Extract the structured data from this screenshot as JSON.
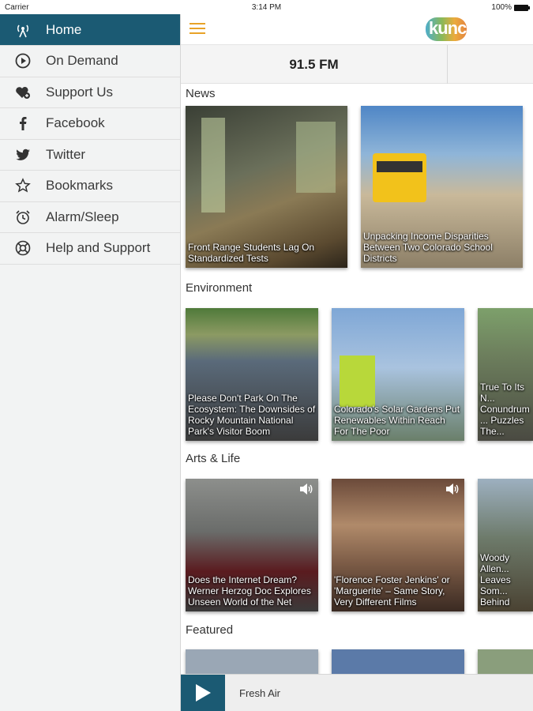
{
  "status": {
    "carrier": "Carrier",
    "time": "3:14 PM",
    "battery": "100%"
  },
  "sidebar": {
    "items": [
      {
        "label": "Home",
        "icon": "radio-tower-icon",
        "active": true
      },
      {
        "label": "On Demand",
        "icon": "play-circle-icon"
      },
      {
        "label": "Support Us",
        "icon": "heart-plus-icon"
      },
      {
        "label": "Facebook",
        "icon": "facebook-icon"
      },
      {
        "label": "Twitter",
        "icon": "twitter-icon"
      },
      {
        "label": "Bookmarks",
        "icon": "star-icon"
      },
      {
        "label": "Alarm/Sleep",
        "icon": "alarm-clock-icon"
      },
      {
        "label": "Help and Support",
        "icon": "help-lifebuoy-icon"
      }
    ]
  },
  "header": {
    "logo_text": "kunc",
    "menu_icon": "hamburger-icon"
  },
  "stations": [
    {
      "label": "91.5 FM"
    }
  ],
  "sections": {
    "news": {
      "title": "News",
      "cards": [
        {
          "caption": "Front Range Students Lag On Standardized Tests"
        },
        {
          "caption": "Unpacking Income Disparities Between Two Colorado School Districts"
        }
      ]
    },
    "environment": {
      "title": "Environment",
      "cards": [
        {
          "caption": "Please Don't Park On The Ecosystem: The Downsides of Rocky Mountain National Park's Visitor Boom"
        },
        {
          "caption": "Colorado's Solar Gardens Put Renewables Within Reach For The Poor"
        },
        {
          "caption": "True To Its N... Conundrum ... Puzzles The..."
        }
      ]
    },
    "arts": {
      "title": "Arts & Life",
      "cards": [
        {
          "caption": "Does the Internet Dream? Werner Herzog Doc Explores Unseen World of the Net",
          "audio": true
        },
        {
          "caption": "'Florence Foster Jenkins' or 'Marguerite' – Same Story, Very Different Films",
          "audio": true
        },
        {
          "caption": "Woody Allen... Leaves Som... Behind",
          "audio": false
        }
      ]
    },
    "featured": {
      "title": "Featured"
    }
  },
  "player": {
    "now_playing": "Fresh Air"
  },
  "colors": {
    "accent": "#1b5a73",
    "menu": "#e8a227"
  }
}
